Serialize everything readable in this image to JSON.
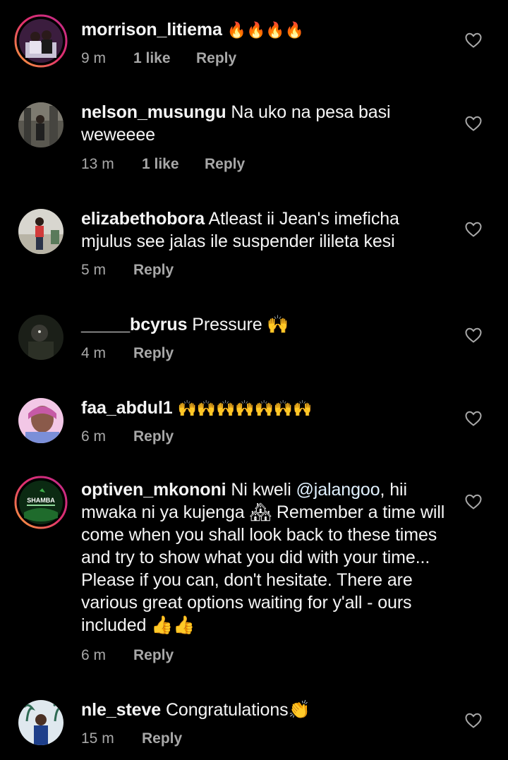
{
  "comments": [
    {
      "username": "morrison_litiema",
      "text": "🔥🔥🔥🔥",
      "time": "9 m",
      "likes": "1 like",
      "reply": "Reply"
    },
    {
      "username": "nelson_musungu",
      "text": "Na uko na pesa basi weweeee",
      "time": "13 m",
      "likes": "1 like",
      "reply": "Reply"
    },
    {
      "username": "elizabethobora",
      "text": "Atleast ii Jean's imeficha mjulus see jalas ile suspender ilileta kesi",
      "time": "5 m",
      "reply": "Reply"
    },
    {
      "username": "_____bcyrus",
      "text": "Pressure 🙌",
      "time": "4 m",
      "reply": "Reply"
    },
    {
      "username": "faa_abdul1",
      "text": "🙌🙌🙌🙌🙌🙌🙌",
      "time": "6 m",
      "reply": "Reply"
    },
    {
      "username": "optiven_mkononi",
      "text_before": "Ni kweli ",
      "mention": "@jalangoo",
      "text_after": ", hii mwaka ni ya kujenga 🏘 Remember a time will come when you shall look back to these times and try to show what you did with your time... Please if you can, don't hesitate. There are various great options waiting for y'all - ours included 👍👍",
      "avatar_text": "SHAMBA",
      "time": "6 m",
      "reply": "Reply"
    },
    {
      "username": "nle_steve",
      "text": "Congratulations👏",
      "time": "15 m",
      "reply": "Reply"
    }
  ]
}
